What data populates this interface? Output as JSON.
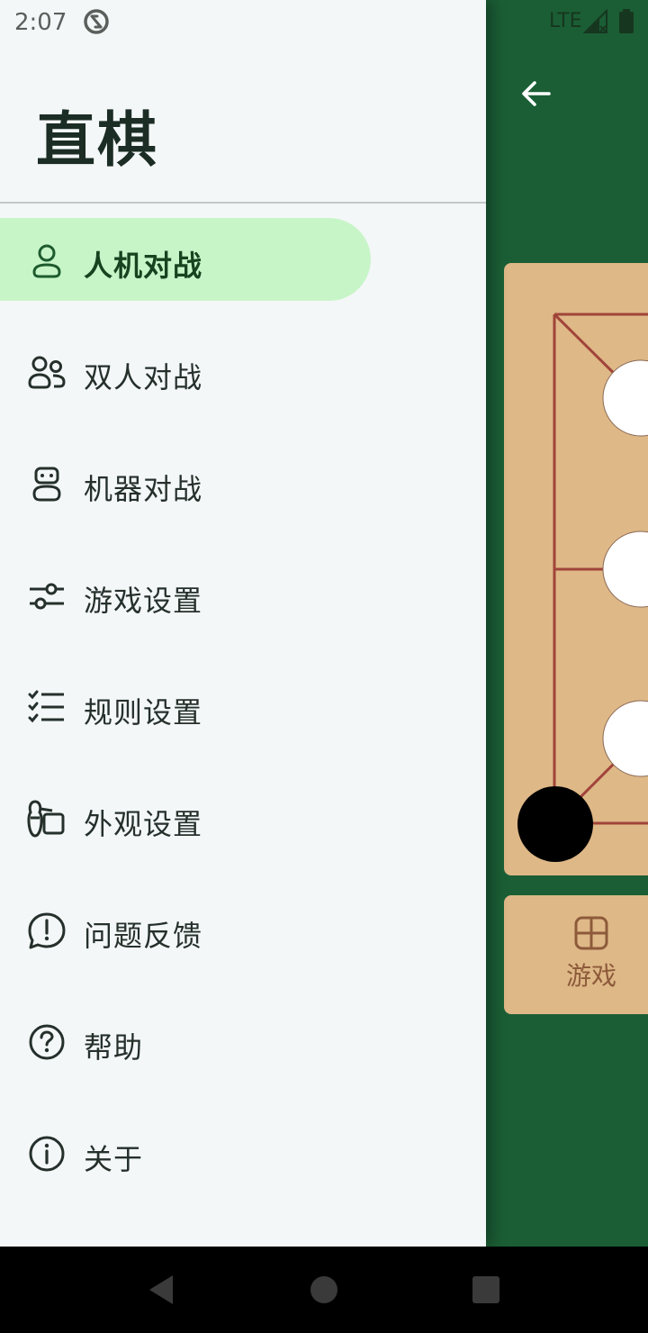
{
  "status_bar": {
    "time": "2:07",
    "network": "LTE",
    "icons": [
      "sync-icon",
      "signal-icon",
      "battery-icon"
    ]
  },
  "drawer": {
    "title": "直棋",
    "items": [
      {
        "label": "人机对战",
        "icon": "person-icon",
        "active": true
      },
      {
        "label": "双人对战",
        "icon": "two-people-icon",
        "active": false
      },
      {
        "label": "机器对战",
        "icon": "robot-icon",
        "active": false
      },
      {
        "label": "游戏设置",
        "icon": "sliders-icon",
        "active": false
      },
      {
        "label": "规则设置",
        "icon": "checklist-icon",
        "active": false
      },
      {
        "label": "外观设置",
        "icon": "palette-icon",
        "active": false
      },
      {
        "label": "问题反馈",
        "icon": "feedback-icon",
        "active": false
      },
      {
        "label": "帮助",
        "icon": "help-icon",
        "active": false
      },
      {
        "label": "关于",
        "icon": "info-icon",
        "active": false
      }
    ]
  },
  "background_app": {
    "back_icon": "arrow-left-icon",
    "bottom_tab": {
      "label": "游戏",
      "icon": "grid-icon"
    }
  },
  "colors": {
    "app_green": "#1b5e35",
    "board_tan": "#deb887",
    "board_lines": "#a0443a",
    "drawer_bg": "#f4f7f8",
    "active_pill": "#c8f5c8",
    "active_text": "#17431f"
  }
}
